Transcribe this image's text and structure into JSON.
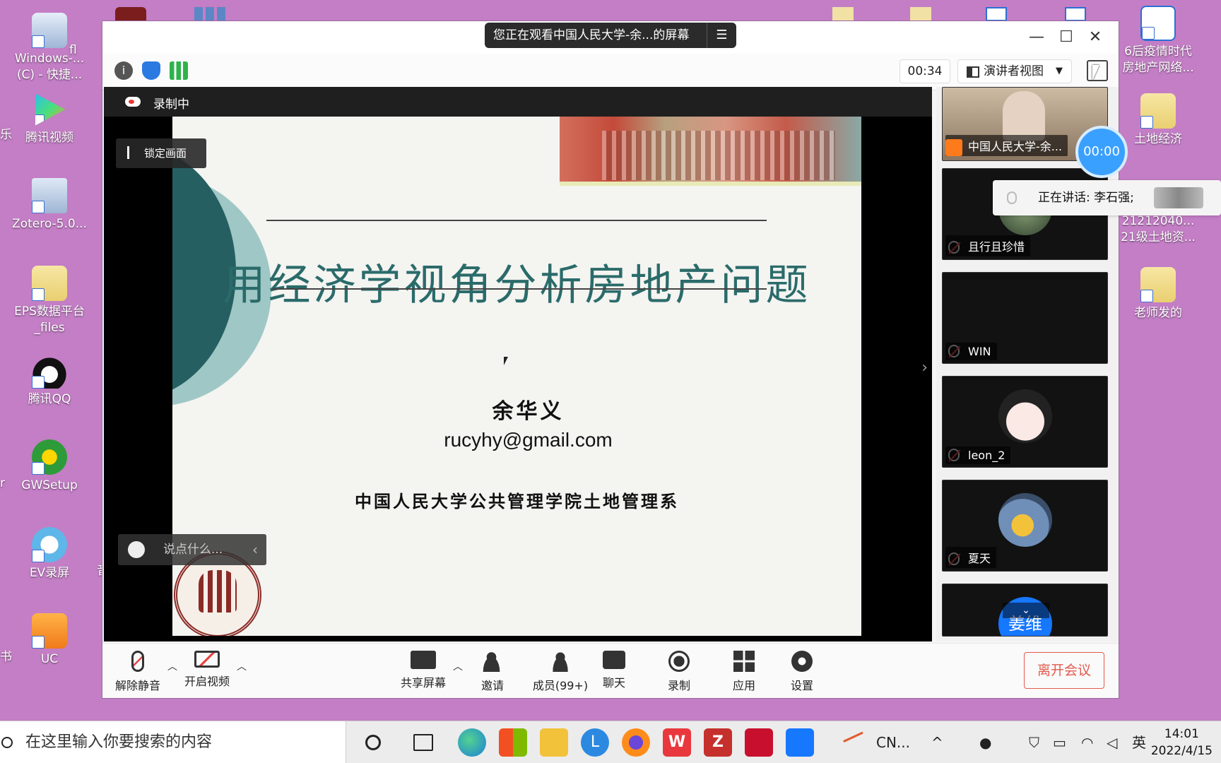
{
  "desktop": {
    "left_icons": [
      {
        "label": "Windows-...\n(C) - 快捷..."
      },
      {
        "label": "腾讯视频"
      },
      {
        "label": "Zotero-5.0..."
      },
      {
        "label": "EPS数据平台\n_files"
      },
      {
        "label": "腾讯QQ"
      },
      {
        "label": "GWSetup"
      },
      {
        "label": "EV录屏"
      },
      {
        "label": "UC"
      }
    ],
    "left_edge": [
      "fl",
      "乐",
      "r",
      "音",
      "书"
    ],
    "right_icons": [
      {
        "label": "6后疫情时代\n房地产网络..."
      },
      {
        "label": "土地经济"
      },
      {
        "label": "21212040...\n21级土地资..."
      },
      {
        "label": "老师发的"
      }
    ]
  },
  "meeting": {
    "share_banner": "您正在观看中国人民大学-余...的屏幕",
    "timer": "00:34",
    "view_mode": "演讲者视图",
    "recording_label": "录制中",
    "lock_screen": "锁定画面",
    "chat_placeholder": "说点什么...",
    "slide": {
      "title": "用经济学视角分析房地产问题",
      "author": "余华义",
      "email": "rucyhy@gmail.com",
      "affiliation": "中国人民大学公共管理学院土地管理系"
    },
    "speaking": "正在讲话: 李石强;",
    "bubble_timer": "00:00",
    "participants": [
      {
        "name": "中国人民大学-余...",
        "muted": false
      },
      {
        "name": "且行且珍惜",
        "muted": true
      },
      {
        "name": "WIN",
        "muted": true
      },
      {
        "name": "leon_2",
        "muted": true
      },
      {
        "name": "夏天",
        "muted": true
      },
      {
        "name": "姜维",
        "muted": true
      }
    ],
    "controls": {
      "unmute": "解除静音",
      "video": "开启视频",
      "share": "共享屏幕",
      "invite": "邀请",
      "members": "成员(99+)",
      "chat": "聊天",
      "record": "录制",
      "apps": "应用",
      "settings": "设置",
      "leave": "离开会议"
    }
  },
  "taskbar": {
    "search_placeholder": "在这里输入你要搜索的内容",
    "stock": "CN...",
    "ime": "英",
    "time": "14:01",
    "date": "2022/4/15"
  },
  "colors": {
    "desktop_bg": "#c37ec5",
    "slide_title": "#2a6b6a",
    "leave": "#e35a4d",
    "accent": "#3aa0ff"
  }
}
